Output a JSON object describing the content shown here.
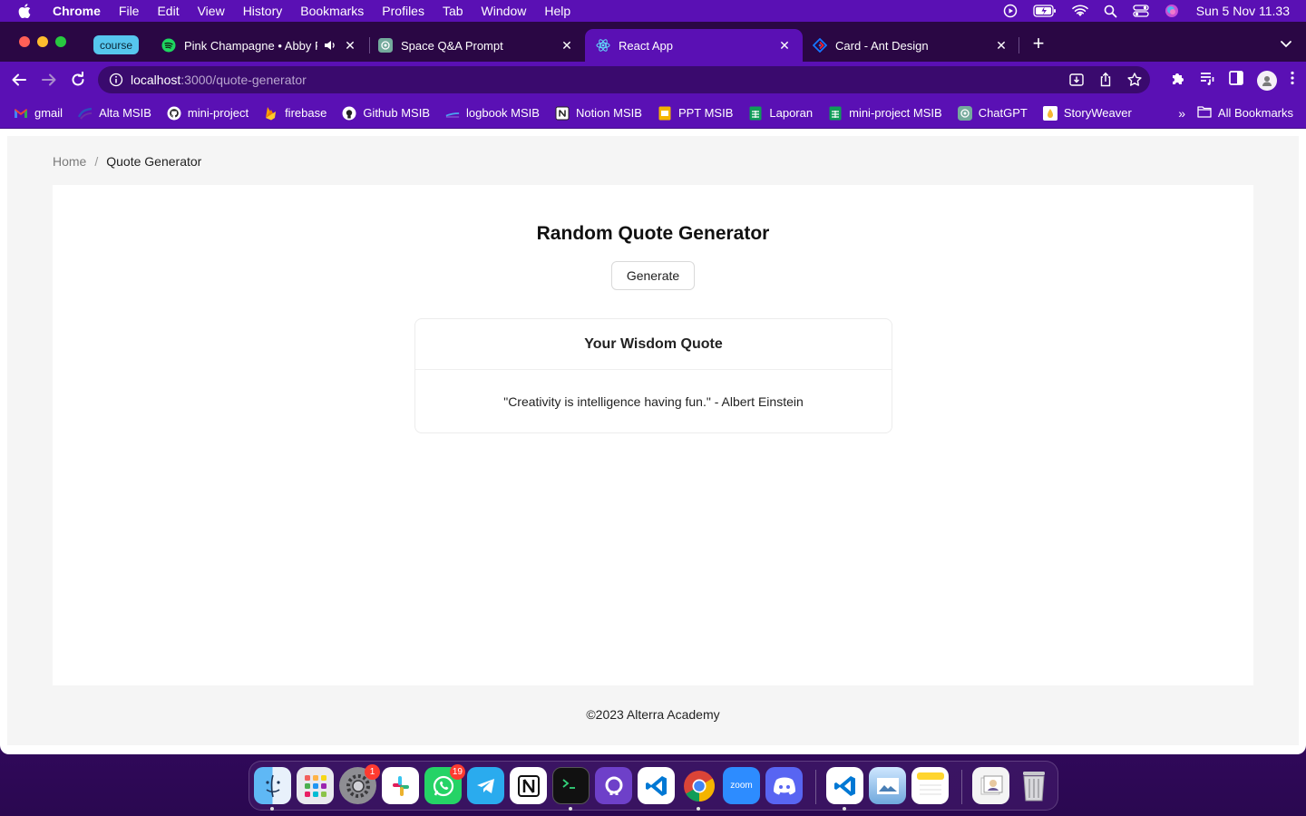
{
  "menubar": {
    "app_name": "Chrome",
    "menus": [
      "File",
      "Edit",
      "View",
      "History",
      "Bookmarks",
      "Profiles",
      "Tab",
      "Window",
      "Help"
    ],
    "clock": "Sun 5 Nov  11.33"
  },
  "tabs": {
    "group_label": "course",
    "items": [
      {
        "title": "Pink Champagne • Abby R",
        "icon": "spotify-icon"
      },
      {
        "title": "Space Q&A Prompt",
        "icon": "openai-icon"
      },
      {
        "title": "React App",
        "icon": "react-icon"
      },
      {
        "title": "Card - Ant Design",
        "icon": "antdesign-icon"
      }
    ],
    "active_index": 2,
    "new_tab": "+"
  },
  "address_bar": {
    "host": "localhost",
    "path": ":3000/quote-generator"
  },
  "bookmarks": {
    "items": [
      {
        "label": "gmail",
        "icon": "gmail-icon"
      },
      {
        "label": "Alta MSIB",
        "icon": "alta-icon"
      },
      {
        "label": "mini-project",
        "icon": "github-icon"
      },
      {
        "label": "firebase",
        "icon": "firebase-icon"
      },
      {
        "label": "Github MSIB",
        "icon": "github-icon"
      },
      {
        "label": "logbook MSIB",
        "icon": "logbook-icon"
      },
      {
        "label": "Notion MSIB",
        "icon": "notion-icon"
      },
      {
        "label": "PPT MSIB",
        "icon": "slides-icon"
      },
      {
        "label": "Laporan",
        "icon": "sheets-icon"
      },
      {
        "label": "mini-project MSIB",
        "icon": "sheets-icon"
      },
      {
        "label": "ChatGPT",
        "icon": "openai-icon"
      },
      {
        "label": "StoryWeaver",
        "icon": "storyweaver-icon"
      }
    ],
    "more": "»",
    "all_bookmarks": "All Bookmarks"
  },
  "page": {
    "breadcrumb": {
      "home": "Home",
      "separator": "/",
      "current": "Quote Generator"
    },
    "title": "Random Quote Generator",
    "generate_label": "Generate",
    "card": {
      "title": "Your Wisdom Quote",
      "quote": "\"Creativity is intelligence having fun.\" - Albert Einstein"
    },
    "footer": "©2023 Alterra Academy"
  },
  "dock": {
    "apps": [
      {
        "name": "finder",
        "running": true
      },
      {
        "name": "launchpad",
        "running": false
      },
      {
        "name": "system-settings",
        "running": false,
        "badge": "1"
      },
      {
        "name": "slack",
        "running": false
      },
      {
        "name": "whatsapp",
        "running": false,
        "badge": "19"
      },
      {
        "name": "telegram",
        "running": false
      },
      {
        "name": "notion",
        "running": false
      },
      {
        "name": "terminal",
        "running": true
      },
      {
        "name": "github-desktop",
        "running": false
      },
      {
        "name": "vscode",
        "running": false
      },
      {
        "name": "chrome",
        "running": true
      },
      {
        "name": "zoom",
        "running": false,
        "label": "zoom"
      },
      {
        "name": "discord",
        "running": false
      },
      {
        "name": "vscode-2",
        "running": true
      },
      {
        "name": "preview",
        "running": false
      },
      {
        "name": "notes",
        "running": false
      },
      {
        "name": "downloads-stack",
        "running": false
      },
      {
        "name": "trash",
        "running": false
      }
    ]
  },
  "colors": {
    "menubar": "#5a10b4",
    "tabstrip": "#2a0744",
    "page_bg": "#f5f5f5",
    "group_chip": "#56c6ee"
  }
}
